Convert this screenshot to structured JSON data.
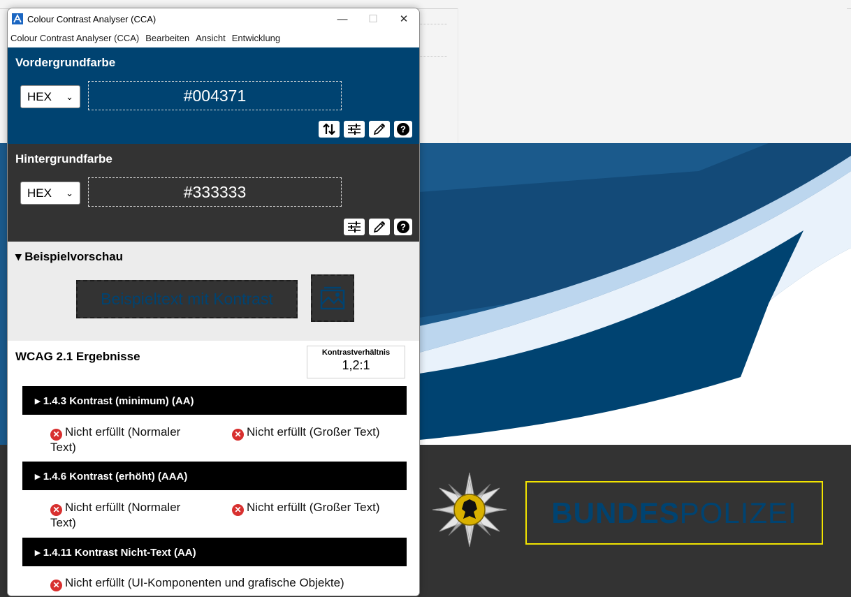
{
  "window": {
    "title": "Colour Contrast Analyser (CCA)",
    "minimize": "—",
    "maximize": "☐",
    "close": "✕"
  },
  "menu": [
    "Colour Contrast Analyser (CCA)",
    "Bearbeiten",
    "Ansicht",
    "Entwicklung"
  ],
  "foreground": {
    "title": "Vordergrundfarbe",
    "format": "HEX",
    "value": "#004371",
    "tools": [
      "swap-icon",
      "sliders-icon",
      "eyedropper-icon",
      "help-icon"
    ]
  },
  "background": {
    "title": "Hintergrundfarbe",
    "format": "HEX",
    "value": "#333333",
    "tools": [
      "sliders-icon",
      "eyedropper-icon",
      "help-icon"
    ]
  },
  "preview": {
    "title": "▾ Beispielvorschau",
    "sample_text": "Beispieltext mit Kontrast",
    "sample_icon": "image-icon"
  },
  "results": {
    "title": "WCAG 2.1 Ergebnisse",
    "ratio_label": "Kontrastverhältnis",
    "ratio_value": "1,2:1",
    "criteria": [
      {
        "label": "▸ 1.4.3 Kontrast (minimum) (AA)",
        "normal_text": "Nicht erfüllt (Normaler",
        "normal_text_cont": "Text)",
        "large_text": "Nicht erfüllt (Großer Text)"
      },
      {
        "label": "▸ 1.4.6 Kontrast (erhöht) (AAA)",
        "normal_text": "Nicht erfüllt (Normaler",
        "normal_text_cont": "Text)",
        "large_text": "Nicht erfüllt (Großer Text)"
      },
      {
        "label": "▸ 1.4.11 Kontrast Nicht-Text (AA)",
        "ui_components": "Nicht erfüllt (UI-Komponenten und grafische Objekte)"
      }
    ]
  },
  "website": {
    "brand_bold": "BUNDES",
    "brand_light": "POLIZEI"
  },
  "colors": {
    "foreground": "#004371",
    "background": "#333333",
    "fail": "#d8302f",
    "highlight_box": "#f2e400"
  }
}
